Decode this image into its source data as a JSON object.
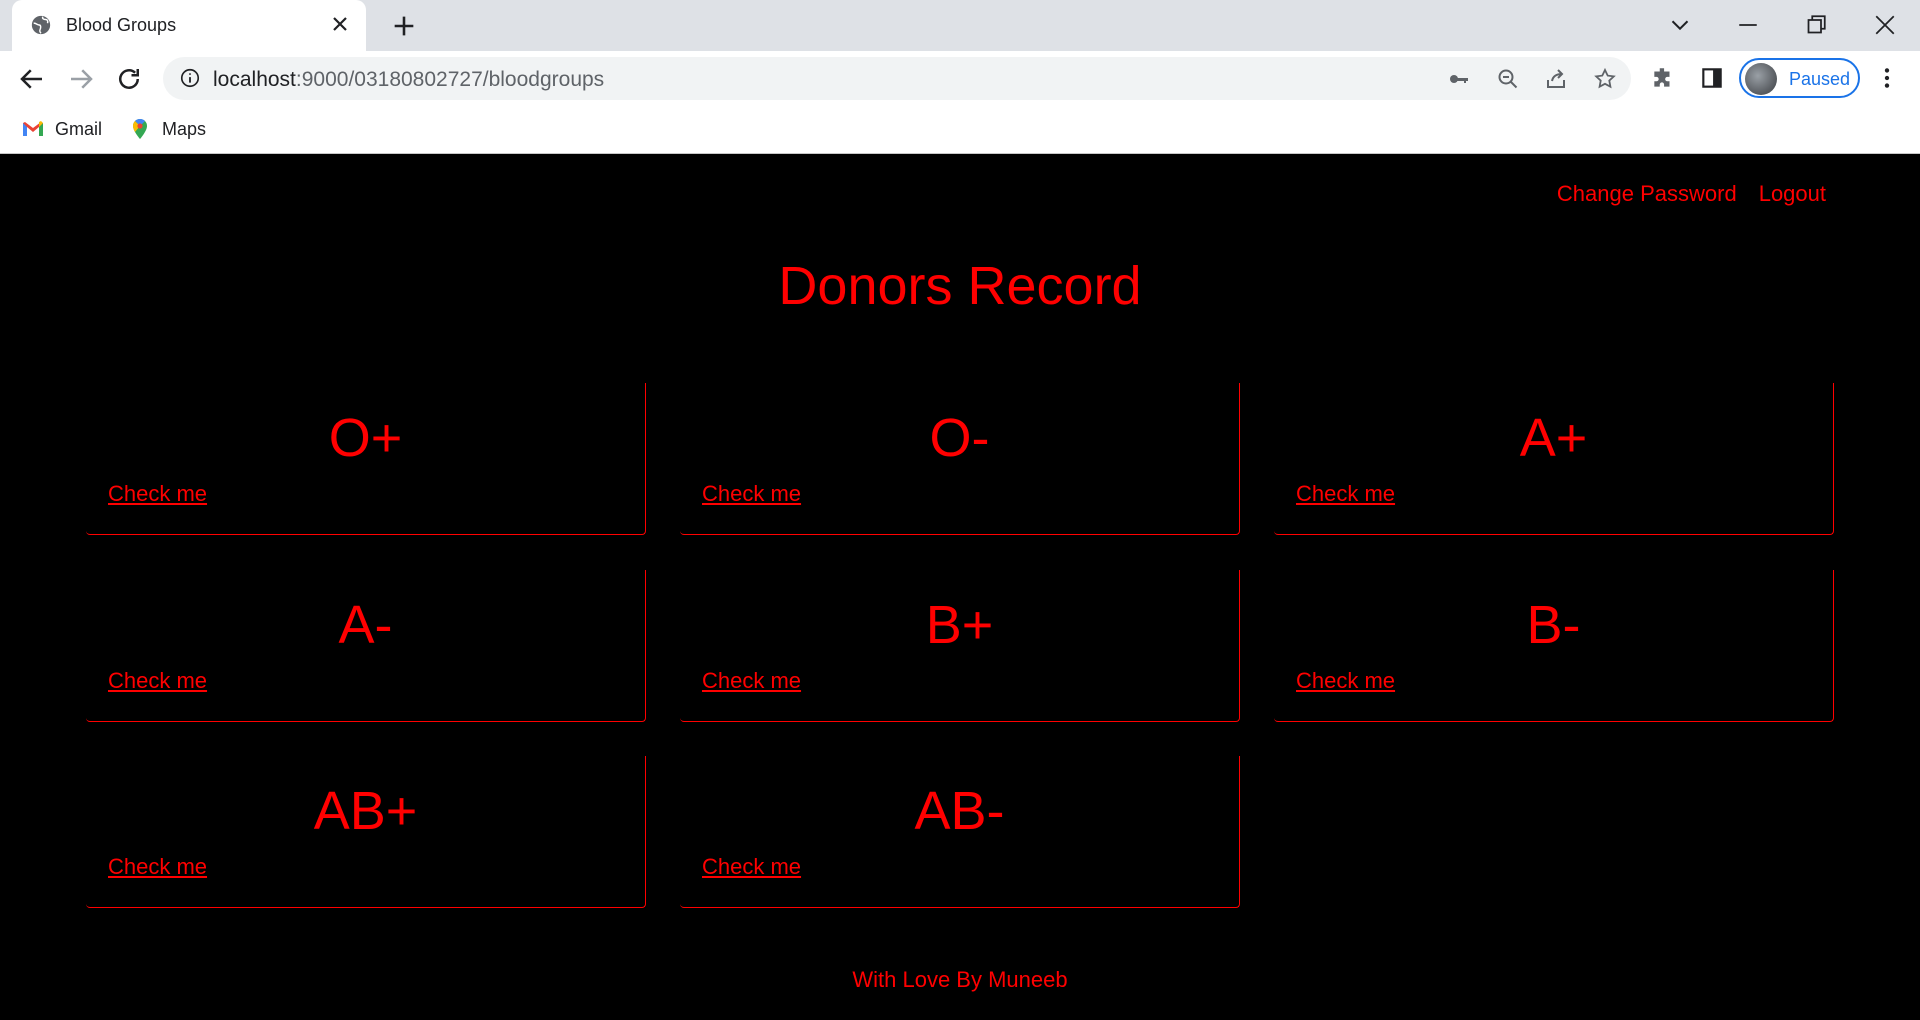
{
  "browser": {
    "tab_title": "Blood Groups",
    "url_host": "localhost",
    "url_rest": ":9000/03180802727/bloodgroups",
    "profile_label": "Paused",
    "bookmarks": [
      {
        "label": "Gmail",
        "icon": "gmail-icon"
      },
      {
        "label": "Maps",
        "icon": "maps-icon"
      }
    ],
    "colors": {
      "accent": "#1a73e8",
      "tabstrip": "#dee1e6"
    }
  },
  "page": {
    "nav": {
      "change_password": "Change Password",
      "logout": "Logout"
    },
    "title": "Donors Record",
    "cards": [
      {
        "group": "O+",
        "link": "Check me"
      },
      {
        "group": "O-",
        "link": "Check me"
      },
      {
        "group": "A+",
        "link": "Check me"
      },
      {
        "group": "A-",
        "link": "Check me"
      },
      {
        "group": "B+",
        "link": "Check me"
      },
      {
        "group": "B-",
        "link": "Check me"
      },
      {
        "group": "AB+",
        "link": "Check me"
      },
      {
        "group": "AB-",
        "link": "Check me"
      }
    ],
    "footer": "With Love By Muneeb",
    "colors": {
      "text": "#ff0000",
      "background": "#000000"
    }
  }
}
